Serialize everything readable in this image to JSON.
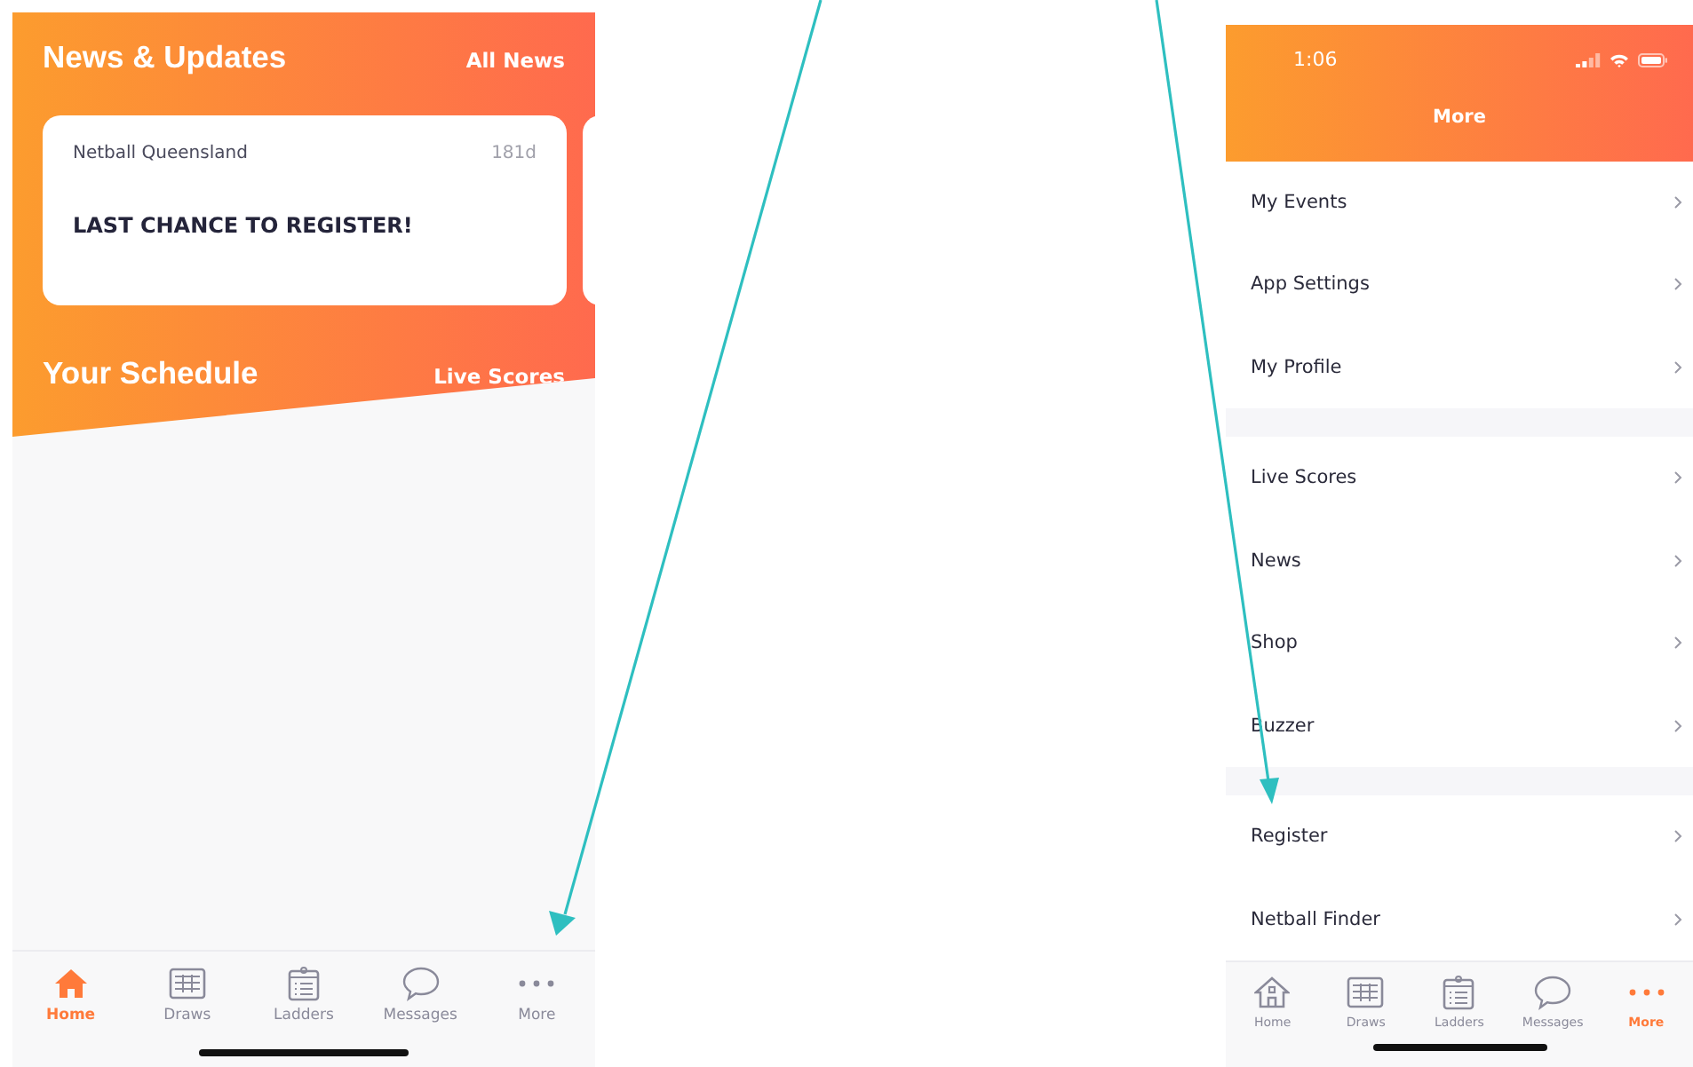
{
  "home_screen": {
    "header": {
      "title": "News & Updates",
      "link": "All News"
    },
    "news_cards": [
      {
        "source": "Netball Queensland",
        "age": "181d",
        "headline": "LAST CHANCE TO REGISTER!"
      }
    ],
    "schedule": {
      "title": "Your Schedule",
      "link": "Live Scores"
    },
    "tab_bar": [
      {
        "label": "Home",
        "selected": true
      },
      {
        "label": "Draws",
        "selected": false
      },
      {
        "label": "Ladders",
        "selected": false
      },
      {
        "label": "Messages",
        "selected": false
      },
      {
        "label": "More",
        "selected": false
      }
    ]
  },
  "more_screen": {
    "status_bar": {
      "time": "1:06"
    },
    "title": "More",
    "menu_groups": [
      [
        "My Events",
        "App Settings",
        "My Profile"
      ],
      [
        "Live Scores",
        "News",
        "Shop",
        "Buzzer"
      ],
      [
        "Register",
        "Netball Finder"
      ]
    ],
    "tab_bar": [
      {
        "label": "Home",
        "selected": false
      },
      {
        "label": "Draws",
        "selected": false
      },
      {
        "label": "Ladders",
        "selected": false
      },
      {
        "label": "Messages",
        "selected": false
      },
      {
        "label": "More",
        "selected": true
      }
    ]
  }
}
